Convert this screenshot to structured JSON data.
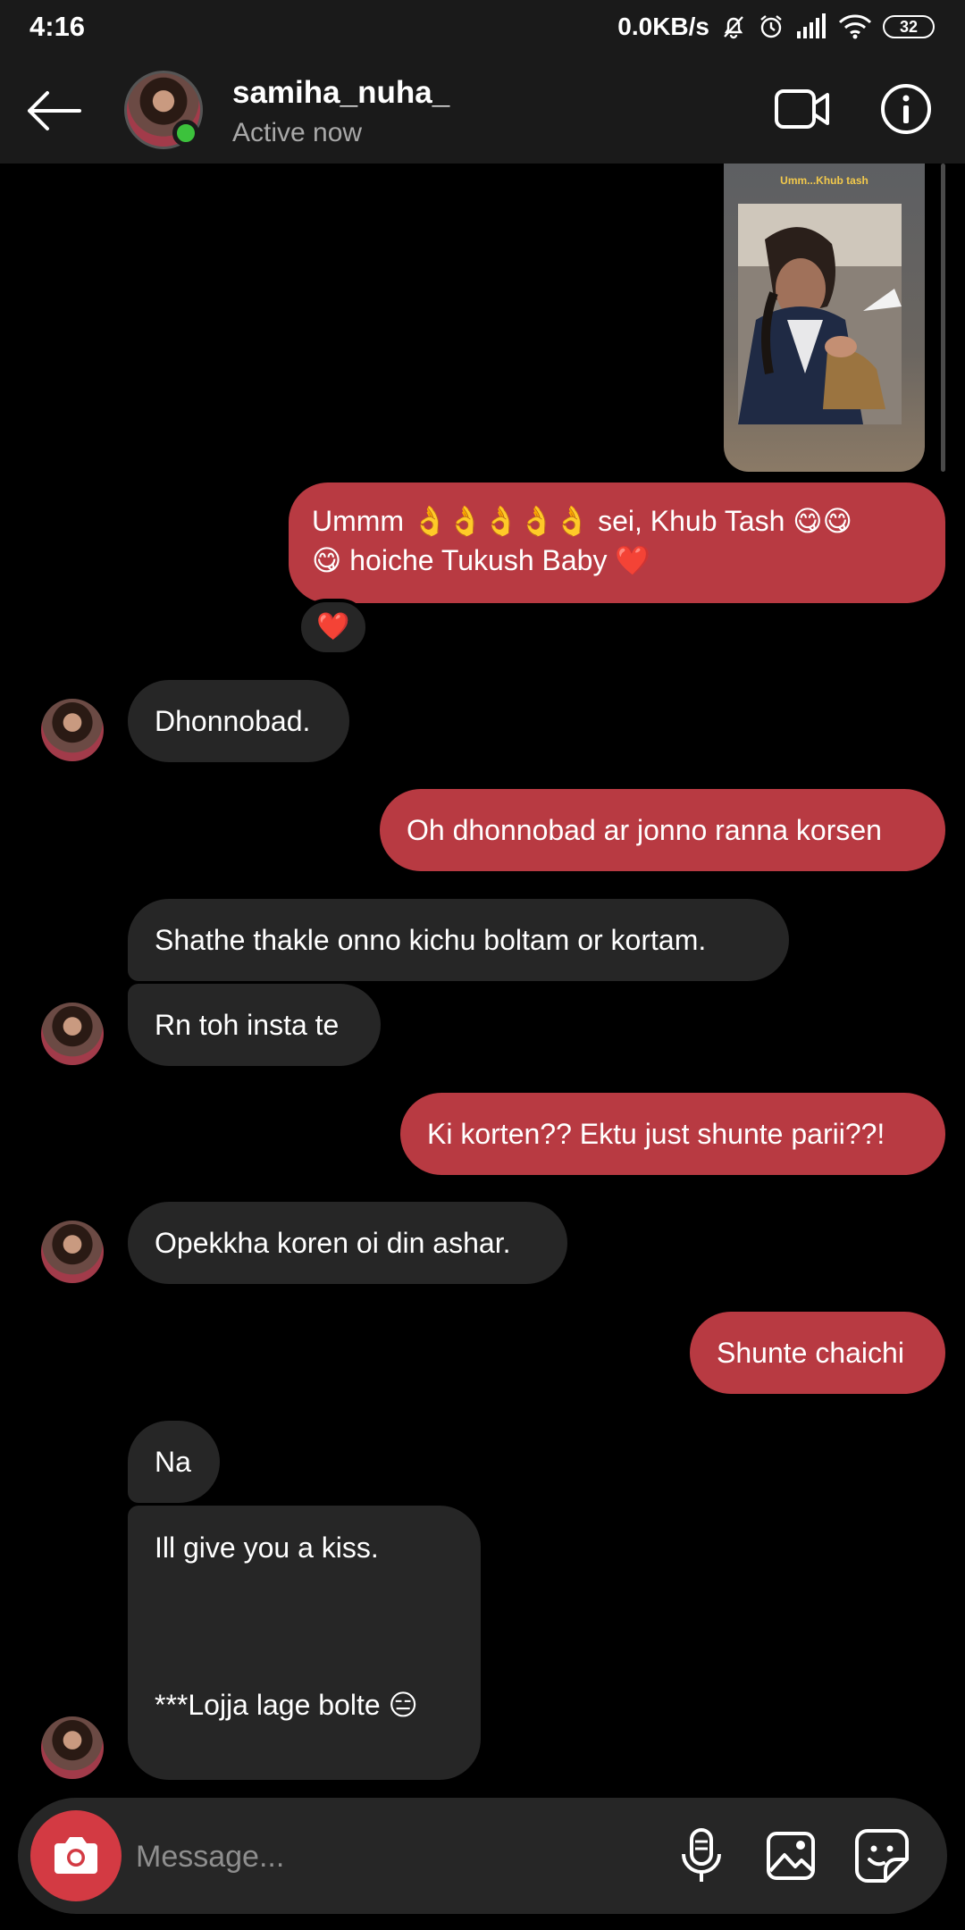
{
  "status_bar": {
    "time": "4:16",
    "network_speed": "0.0KB/s",
    "battery": "32"
  },
  "header": {
    "username": "samiha_nuha_",
    "status": "Active now"
  },
  "story": {
    "caption": "Umm...Khub tash"
  },
  "messages": [
    {
      "sender": "me",
      "text": "Ummm 👌👌👌👌👌 sei, Khub Tash 😋😋\n😋 hoiche Tukush Baby ❤️",
      "reaction": "❤️"
    },
    {
      "sender": "them",
      "text": "Dhonnobad."
    },
    {
      "sender": "me",
      "text": "Oh dhonnobad ar jonno ranna korsen"
    },
    {
      "sender": "them",
      "text": "Shathe thakle onno kichu boltam or kortam."
    },
    {
      "sender": "them",
      "text": "Rn toh insta te"
    },
    {
      "sender": "me",
      "text": "Ki korten?? Ektu just shunte parii??!"
    },
    {
      "sender": "them",
      "text": "Opekkha koren oi din ashar."
    },
    {
      "sender": "me",
      "text": "Shunte chaichi"
    },
    {
      "sender": "them",
      "text": "Na"
    },
    {
      "sender": "them",
      "text": "Ill give you a kiss.\n\n\n\n***Lojja lage bolte 😑"
    }
  ],
  "composer": {
    "placeholder": "Message..."
  },
  "icons": {
    "back": "back-arrow-icon",
    "video": "video-camera-icon",
    "info": "info-icon",
    "camera": "camera-icon",
    "mic": "microphone-icon",
    "gallery": "image-gallery-icon",
    "sticker": "sticker-icon"
  },
  "colors": {
    "outgoing_bubble": "#b83a42",
    "incoming_bubble": "#262626",
    "header_bg": "#1a1a1a",
    "camera_button": "#d33a43",
    "online": "#3cc23c"
  }
}
